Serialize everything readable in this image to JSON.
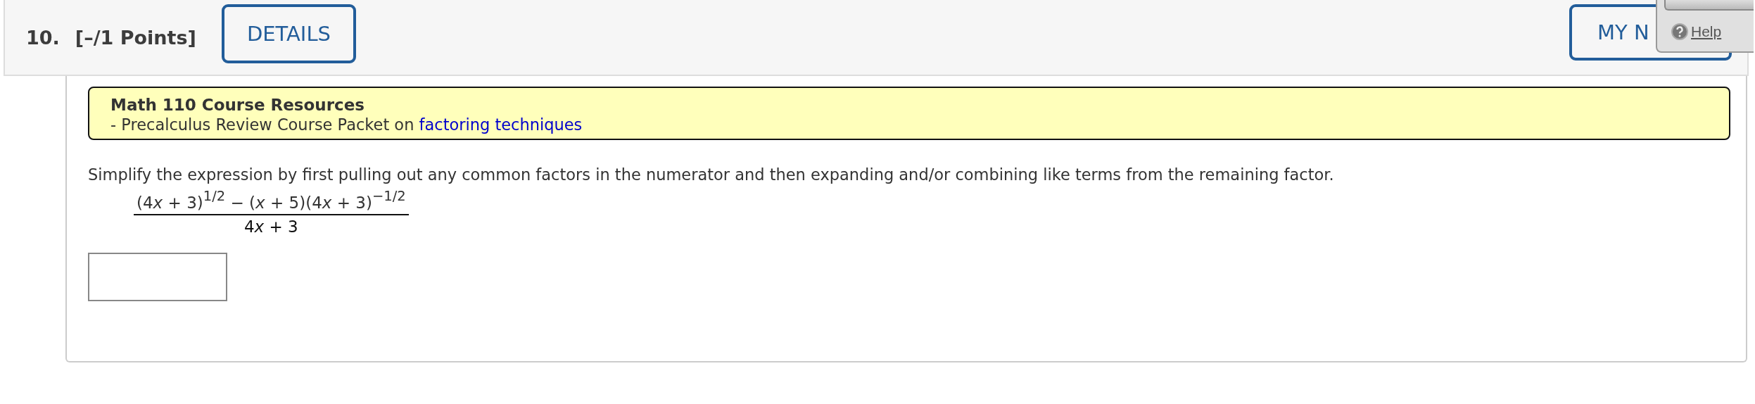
{
  "question": {
    "number": "10.",
    "points": "[–/1 Points]",
    "buttons": [
      {
        "label": "DETAILS"
      },
      {
        "label": "MY N"
      }
    ]
  },
  "help_popup": {
    "link": "Help"
  },
  "resources": {
    "title": "Math 110 Course Resources",
    "line_prefix": "- Precalculus Review Course Packet on ",
    "link": "factoring techniques"
  },
  "prompt": "Simplify the expression by first pulling out any common factors in the numerator and then expanding and/or combining like terms from the remaining factor.",
  "expression": {
    "numerator": [
      {
        "kind": "text",
        "text": "(4"
      },
      {
        "kind": "var",
        "text": "x"
      },
      {
        "kind": "text",
        "text": " + 3)"
      },
      {
        "kind": "sup",
        "text": "1/2"
      },
      {
        "kind": "text",
        "text": " − ("
      },
      {
        "kind": "var",
        "text": "x"
      },
      {
        "kind": "text",
        "text": " + 5)(4"
      },
      {
        "kind": "var",
        "text": "x"
      },
      {
        "kind": "text",
        "text": " + 3)"
      },
      {
        "kind": "sup",
        "text": "−1/2"
      }
    ],
    "denominator": [
      {
        "kind": "text",
        "text": "4"
      },
      {
        "kind": "var",
        "text": "x"
      },
      {
        "kind": "text",
        "text": " + 3"
      }
    ]
  }
}
